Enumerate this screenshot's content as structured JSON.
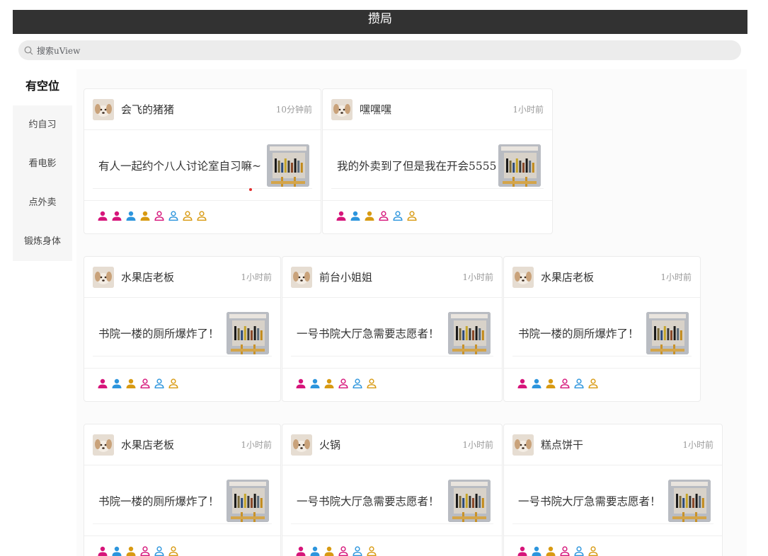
{
  "app": {
    "title": "攒局"
  },
  "search": {
    "placeholder": "搜索uView"
  },
  "sidebar": {
    "items": [
      "有空位",
      "约自习",
      "看电影",
      "点外卖",
      "锻炼身体"
    ]
  },
  "colors": {
    "magenta": "#d6157a",
    "blue": "#2c95dd",
    "gold": "#d89a12"
  },
  "cards": [
    {
      "name": "会飞的猪猪",
      "time": "10分钟前",
      "text": "有人一起约个八人讨论室自习嘛~",
      "people": [
        "magenta-filled",
        "magenta-filled",
        "blue-filled",
        "gold-filled",
        "magenta-outline",
        "blue-outline",
        "gold-outline",
        "gold-outline"
      ]
    },
    {
      "name": "嘿嘿嘿",
      "time": "1小时前",
      "text": "我的外卖到了但是我在开会5555",
      "people": [
        "magenta-filled",
        "blue-filled",
        "gold-filled",
        "magenta-outline",
        "blue-outline",
        "gold-outline"
      ]
    },
    {
      "name": "水果店老板",
      "time": "1小时前",
      "text": "书院一楼的厕所爆炸了！",
      "people": [
        "magenta-filled",
        "blue-filled",
        "gold-filled",
        "magenta-outline",
        "blue-outline",
        "gold-outline"
      ]
    },
    {
      "name": "前台小姐姐",
      "time": "1小时前",
      "text": "一号书院大厅急需要志愿者！",
      "people": [
        "magenta-filled",
        "blue-filled",
        "gold-filled",
        "magenta-outline",
        "blue-outline",
        "gold-outline"
      ]
    },
    {
      "name": "水果店老板",
      "time": "1小时前",
      "text": "书院一楼的厕所爆炸了！",
      "people": [
        "magenta-filled",
        "blue-filled",
        "gold-filled",
        "magenta-outline",
        "blue-outline",
        "gold-outline"
      ]
    },
    {
      "name": "水果店老板",
      "time": "1小时前",
      "text": "书院一楼的厕所爆炸了！",
      "people": [
        "magenta-filled",
        "blue-filled",
        "gold-filled",
        "magenta-outline",
        "blue-outline",
        "gold-outline"
      ]
    },
    {
      "name": "火锅",
      "time": "1小时前",
      "text": "一号书院大厅急需要志愿者！",
      "people": [
        "magenta-filled",
        "blue-filled",
        "gold-filled",
        "magenta-outline",
        "blue-outline",
        "gold-outline"
      ]
    },
    {
      "name": "糕点饼干",
      "time": "1小时前",
      "text": "一号书院大厅急需要志愿者！",
      "people": [
        "magenta-filled",
        "blue-filled",
        "gold-filled",
        "magenta-outline",
        "blue-outline",
        "gold-outline"
      ]
    }
  ]
}
